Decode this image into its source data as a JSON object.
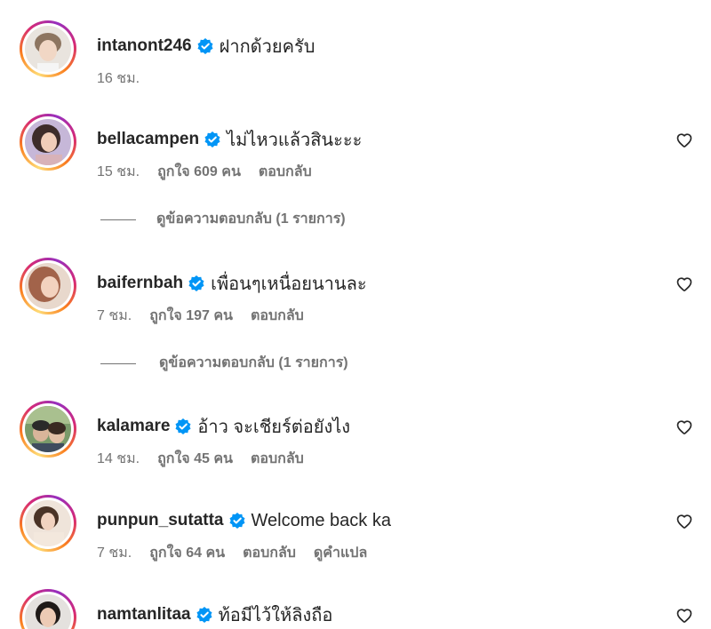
{
  "comments": [
    {
      "username": "intanont246",
      "verified": true,
      "text": "ฝากด้วยครับ",
      "time": "16 ชม.",
      "likes": "",
      "reply": "",
      "translate": "",
      "heart": false
    },
    {
      "username": "bellacampen",
      "verified": true,
      "text": "ไม่ไหวแล้วสินะะะ",
      "time": "15 ชม.",
      "likes": "ถูกใจ 609 คน",
      "reply": "ตอบกลับ",
      "translate": "",
      "heart": true
    },
    {
      "username": "baifernbah",
      "verified": true,
      "text": "เพื่อนๆเหนื่อยนานละ",
      "time": "7 ชม.",
      "likes": "ถูกใจ 197 คน",
      "reply": "ตอบกลับ",
      "translate": "",
      "heart": true
    },
    {
      "username": "kalamare",
      "verified": true,
      "text": "อ้าว จะเชียร์ต่อยังไง",
      "time": "14 ชม.",
      "likes": "ถูกใจ 45 คน",
      "reply": "ตอบกลับ",
      "translate": "",
      "heart": true
    },
    {
      "username": "punpun_sutatta",
      "verified": true,
      "text": "Welcome back ka",
      "time": "7 ชม.",
      "likes": "ถูกใจ 64 คน",
      "reply": "ตอบกลับ",
      "translate": "ดูคำแปล",
      "heart": true
    },
    {
      "username": "namtanlitaa",
      "verified": true,
      "text": "ท้อมีไว้ให้ลิงถือ",
      "time": "",
      "likes": "",
      "reply": "",
      "translate": "",
      "heart": true
    }
  ],
  "view_replies": [
    {
      "label": "ดูข้อความตอบกลับ (1 รายการ)"
    },
    {
      "label": "ดูข้อความตอบกลับ (1 รายการ)"
    }
  ],
  "colors": {
    "text": "#262626",
    "muted": "#737373",
    "verified_blue": "#0095f6"
  },
  "icons": {
    "verified": "verified-badge-icon",
    "like": "heart-outline-icon"
  }
}
